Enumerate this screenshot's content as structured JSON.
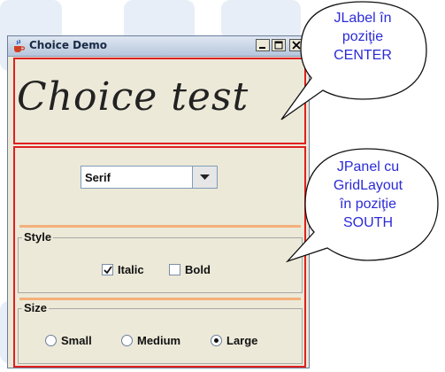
{
  "window": {
    "title": "Choice Demo",
    "label_text": "Choice test"
  },
  "combo": {
    "selected": "Serif"
  },
  "style_group": {
    "title": "Style",
    "options": [
      {
        "label": "Italic",
        "checked": true
      },
      {
        "label": "Bold",
        "checked": false
      }
    ]
  },
  "size_group": {
    "title": "Size",
    "options": [
      {
        "label": "Small",
        "selected": false
      },
      {
        "label": "Medium",
        "selected": false
      },
      {
        "label": "Large",
        "selected": true
      }
    ]
  },
  "callouts": {
    "label_callout": [
      "JLabel în",
      "poziţie",
      "CENTER"
    ],
    "panel_callout": [
      "JPanel cu",
      "GridLayout",
      "în poziţie",
      "SOUTH"
    ]
  },
  "colors": {
    "highlight": "#e02020",
    "callout_text": "#2b2bd8",
    "separator": "#f4b07a"
  }
}
